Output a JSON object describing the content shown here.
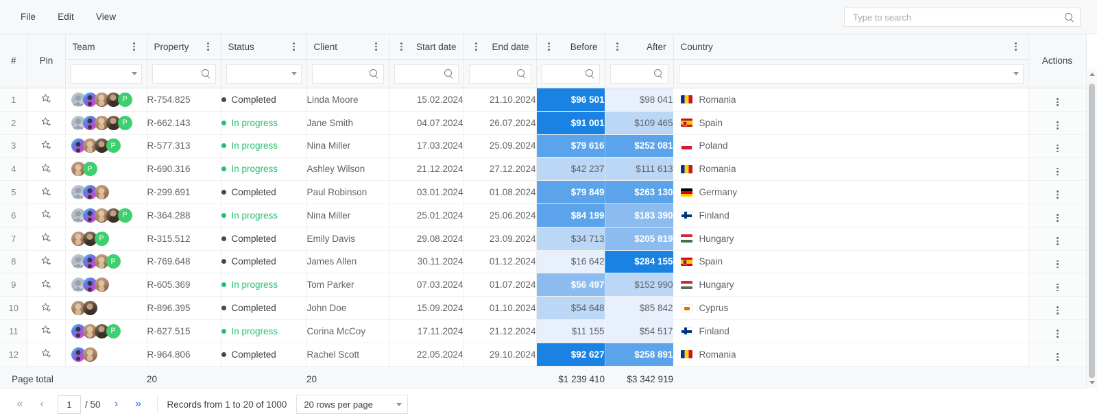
{
  "menu": {
    "items": [
      "File",
      "Edit",
      "View"
    ]
  },
  "search": {
    "placeholder": "Type to search",
    "value": "",
    "icon": "search-icon"
  },
  "columns": {
    "num": "#",
    "pin": "Pin",
    "team": "Team",
    "property": "Property",
    "status": "Status",
    "client": "Client",
    "start_date": "Start date",
    "end_date": "End date",
    "before": "Before",
    "after": "After",
    "country": "Country",
    "actions": "Actions"
  },
  "filters": {
    "team": "",
    "property": "",
    "status": "",
    "client": "",
    "start_date": "",
    "end_date": "",
    "before": "",
    "after": "",
    "country": ""
  },
  "rows": [
    {
      "num": "1",
      "avatars": [
        "a",
        "b",
        "c",
        "d"
      ],
      "plus": true,
      "property": "R-754.825",
      "status": "Completed",
      "status_kind": "completed",
      "client": "Linda Moore",
      "start": "15.02.2024",
      "end": "21.10.2024",
      "before": "$96 501",
      "before_level": 5,
      "after": "$98 041",
      "after_level": 1,
      "country": "Romania",
      "flag": "romania"
    },
    {
      "num": "2",
      "avatars": [
        "a",
        "b",
        "c",
        "d"
      ],
      "plus": true,
      "property": "R-662.143",
      "status": "In progress",
      "status_kind": "inprogress",
      "client": "Jane Smith",
      "start": "04.07.2024",
      "end": "26.07.2024",
      "before": "$91 001",
      "before_level": 5,
      "after": "$109 465",
      "after_level": 2,
      "country": "Spain",
      "flag": "spain"
    },
    {
      "num": "3",
      "avatars": [
        "b",
        "c",
        "d"
      ],
      "plus": true,
      "property": "R-577.313",
      "status": "In progress",
      "status_kind": "inprogress",
      "client": "Nina Miller",
      "start": "17.03.2024",
      "end": "25.09.2024",
      "before": "$79 616",
      "before_level": 4,
      "after": "$252 081",
      "after_level": 4,
      "country": "Poland",
      "flag": "poland"
    },
    {
      "num": "4",
      "avatars": [
        "c"
      ],
      "plus": true,
      "property": "R-690.316",
      "status": "In progress",
      "status_kind": "inprogress",
      "client": "Ashley Wilson",
      "start": "21.12.2024",
      "end": "27.12.2024",
      "before": "$42 237",
      "before_level": 2,
      "after": "$111 613",
      "after_level": 2,
      "country": "Romania",
      "flag": "romania"
    },
    {
      "num": "5",
      "avatars": [
        "a",
        "b",
        "c"
      ],
      "plus": false,
      "property": "R-299.691",
      "status": "Completed",
      "status_kind": "completed",
      "client": "Paul Robinson",
      "start": "03.01.2024",
      "end": "01.08.2024",
      "before": "$79 849",
      "before_level": 4,
      "after": "$263 130",
      "after_level": 4,
      "country": "Germany",
      "flag": "germany"
    },
    {
      "num": "6",
      "avatars": [
        "a",
        "b",
        "c",
        "d"
      ],
      "plus": true,
      "property": "R-364.288",
      "status": "In progress",
      "status_kind": "inprogress",
      "client": "Nina Miller",
      "start": "25.01.2024",
      "end": "25.06.2024",
      "before": "$84 199",
      "before_level": 4,
      "after": "$183 390",
      "after_level": 3,
      "country": "Finland",
      "flag": "finland"
    },
    {
      "num": "7",
      "avatars": [
        "c",
        "d"
      ],
      "plus": true,
      "property": "R-315.512",
      "status": "Completed",
      "status_kind": "completed",
      "client": "Emily Davis",
      "start": "29.08.2024",
      "end": "23.09.2024",
      "before": "$34 713",
      "before_level": 2,
      "after": "$205 819",
      "after_level": 3,
      "country": "Hungary",
      "flag": "hungary"
    },
    {
      "num": "8",
      "avatars": [
        "a",
        "b",
        "c"
      ],
      "plus": true,
      "property": "R-769.648",
      "status": "Completed",
      "status_kind": "completed",
      "client": "James Allen",
      "start": "30.11.2024",
      "end": "01.12.2024",
      "before": "$16 642",
      "before_level": 1,
      "after": "$284 155",
      "after_level": 5,
      "country": "Spain",
      "flag": "spain"
    },
    {
      "num": "9",
      "avatars": [
        "a",
        "b",
        "c"
      ],
      "plus": false,
      "property": "R-605.369",
      "status": "In progress",
      "status_kind": "inprogress",
      "client": "Tom Parker",
      "start": "07.03.2024",
      "end": "01.07.2024",
      "before": "$56 497",
      "before_level": 3,
      "after": "$152 990",
      "after_level": 2,
      "country": "Hungary",
      "flag": "hungary"
    },
    {
      "num": "10",
      "avatars": [
        "c",
        "d"
      ],
      "plus": false,
      "property": "R-896.395",
      "status": "Completed",
      "status_kind": "completed",
      "client": "John Doe",
      "start": "15.09.2024",
      "end": "01.10.2024",
      "before": "$54 648",
      "before_level": 2,
      "after": "$85 842",
      "after_level": 1,
      "country": "Cyprus",
      "flag": "cyprus"
    },
    {
      "num": "11",
      "avatars": [
        "b",
        "c",
        "d"
      ],
      "plus": true,
      "property": "R-627.515",
      "status": "In progress",
      "status_kind": "inprogress",
      "client": "Corina McCoy",
      "start": "17.11.2024",
      "end": "21.12.2024",
      "before": "$11 155",
      "before_level": 1,
      "after": "$54 517",
      "after_level": 1,
      "country": "Finland",
      "flag": "finland"
    },
    {
      "num": "12",
      "avatars": [
        "b",
        "c"
      ],
      "plus": false,
      "property": "R-964.806",
      "status": "Completed",
      "status_kind": "completed",
      "client": "Rachel Scott",
      "start": "22.05.2024",
      "end": "29.10.2024",
      "before": "$92 627",
      "before_level": 5,
      "after": "$258 891",
      "after_level": 4,
      "country": "Romania",
      "flag": "romania"
    }
  ],
  "totals": {
    "label": "Page total",
    "property": "20",
    "client": "20",
    "before": "$1 239 410",
    "after": "$3 342 919"
  },
  "pagination": {
    "first_label": "«",
    "prev_label": "‹",
    "page": "1",
    "of_total": "/ 50",
    "next_label": "›",
    "last_label": "»",
    "records": "Records from 1 to 20 of 1000",
    "rows_per_page": "20 rows per page"
  },
  "colors": {
    "accent": "#1a73e8",
    "status_inprogress": "#21c26b",
    "status_completed": "#44484c",
    "heat_1": "#e8f0fc",
    "heat_2": "#bcd7f5",
    "heat_3": "#8cbcef",
    "heat_4": "#5ba3ea",
    "heat_5": "#1a82e2"
  }
}
